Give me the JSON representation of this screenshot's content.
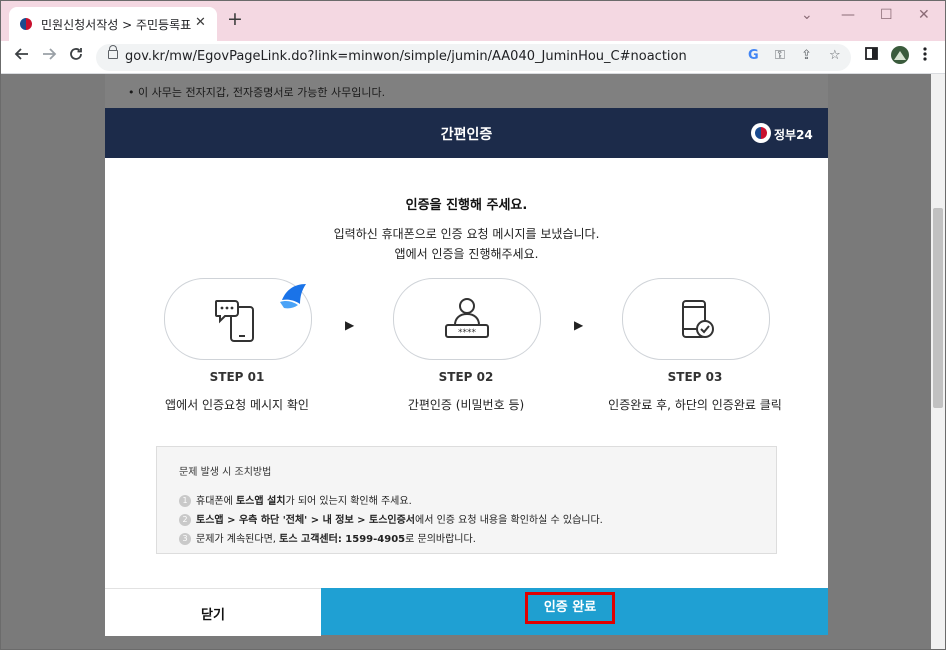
{
  "browser": {
    "tab_title": "민원신청서작성 > 주민등록표 등",
    "tab_close": "✕",
    "new_tab": "+",
    "window_controls": {
      "minimize": "—",
      "maximize": "☐",
      "close": "✕",
      "tablist": "⌄"
    },
    "url": "gov.kr/mw/EgovPageLink.do?link=minwon/simple/jumin/AA040_JuminHou_C#noaction",
    "omnibox_icons": {
      "google": "G",
      "key": "⚿",
      "share": "⇪",
      "star": "☆"
    },
    "accent": "#f4d8e2"
  },
  "page": {
    "background_notice": "• 이 사무는 전자지갑, 전자증명서로 가능한 사무입니다."
  },
  "modal": {
    "title": "간편인증",
    "logo_text": "정부24",
    "heading": "인증을 진행해 주세요.",
    "desc_line1": "입력하신 휴대폰으로 인증 요청 메시지를 보냈습니다.",
    "desc_line2": "앱에서 인증을 진행해주세요.",
    "arrow": "▶",
    "steps": [
      {
        "label": "STEP 01",
        "desc": "앱에서 인증요청 메시지 확인",
        "icon": "phone-message-icon"
      },
      {
        "label": "STEP 02",
        "desc": "간편인증 (비밀번호 등)",
        "icon": "user-password-icon"
      },
      {
        "label": "STEP 03",
        "desc": "인증완료 후, 하단의 인증완료 클릭",
        "icon": "phone-check-icon"
      }
    ],
    "help": {
      "title": "문제 발생 시 조치방법",
      "items": [
        {
          "num": "1",
          "pre": "휴대폰에 ",
          "bold": "토스앱 설치",
          "post": "가 되어 있는지 확인해 주세요."
        },
        {
          "num": "2",
          "pre": "",
          "bold": "토스앱 > 우측 하단 '전체' > 내 정보 > 토스인증서",
          "post": "에서 인증 요청 내용을 확인하실 수 있습니다."
        },
        {
          "num": "3",
          "pre": "문제가 계속된다면, ",
          "bold": "토스 고객센터: 1599-4905",
          "post": "로 문의바랍니다."
        }
      ]
    },
    "close_button": "닫기",
    "done_button": "인증 완료",
    "colors": {
      "header": "#1c2b4a",
      "done": "#1fa0d3",
      "highlight": "#e00000"
    }
  }
}
